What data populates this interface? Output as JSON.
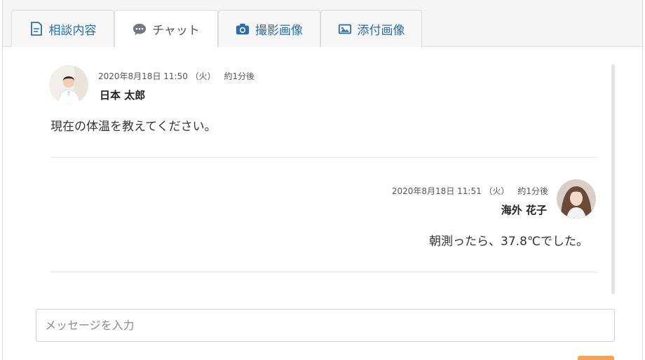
{
  "tabs": [
    {
      "label": "相談内容",
      "icon": "document-icon",
      "active": false
    },
    {
      "label": "チャット",
      "icon": "chat-bubble-icon",
      "active": true
    },
    {
      "label": "撮影画像",
      "icon": "camera-icon",
      "active": false
    },
    {
      "label": "添付画像",
      "icon": "image-icon",
      "active": false
    }
  ],
  "messages": [
    {
      "timestamp": "2020年8月18日 11:50 （火）",
      "relative": "約1分後",
      "sender": "日本 太郎",
      "text": "現在の体温を教えてください。",
      "side": "left"
    },
    {
      "timestamp": "2020年8月18日 11:51 （火）",
      "relative": "約1分後",
      "sender": "海外 花子",
      "text": "朝測ったら、37.8℃でした。",
      "side": "right"
    }
  ],
  "composer": {
    "placeholder": "メッセージを入力",
    "value": ""
  },
  "colors": {
    "tab_text": "#2c6fa8",
    "send_button": "#f0a35a"
  }
}
